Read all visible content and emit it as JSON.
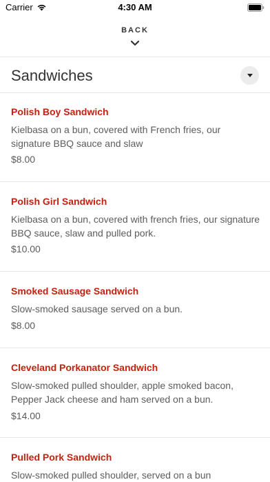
{
  "status_bar": {
    "carrier": "Carrier",
    "time": "4:30 AM"
  },
  "nav": {
    "back_label": "BACK"
  },
  "section": {
    "title": "Sandwiches"
  },
  "items": [
    {
      "name": "Polish Boy Sandwich",
      "description": "Kielbasa on a bun, covered with French fries, our signature BBQ sauce and slaw",
      "price": "$8.00"
    },
    {
      "name": "Polish Girl Sandwich",
      "description": "Kielbasa on a bun, covered with french fries, our signature BBQ sauce, slaw and pulled pork.",
      "price": "$10.00"
    },
    {
      "name": "Smoked Sausage Sandwich",
      "description": "Slow-smoked sausage served on a bun.",
      "price": "$8.00"
    },
    {
      "name": "Cleveland Porkanator Sandwich",
      "description": "Slow-smoked pulled shoulder, apple smoked bacon, Pepper Jack cheese and ham served on a bun.",
      "price": "$14.00"
    },
    {
      "name": "Pulled Pork Sandwich",
      "description": "Slow-smoked pulled shoulder, served on a bun",
      "price": ""
    }
  ]
}
